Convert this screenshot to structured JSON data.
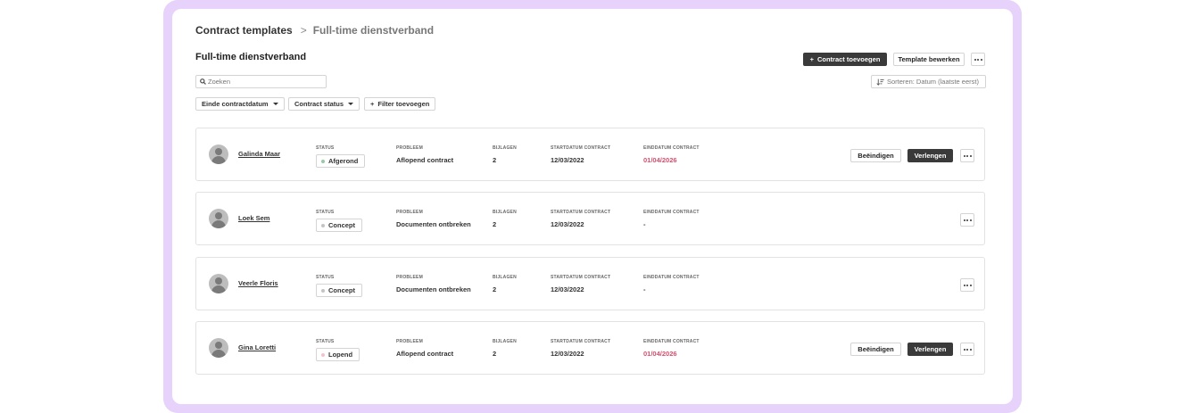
{
  "breadcrumb": {
    "root": "Contract templates",
    "separator": ">",
    "current": "Full-time dienstverband"
  },
  "page_title": "Full-time dienstverband",
  "toolbar": {
    "add_contract": "Contract toevoegen",
    "add_icon": "+",
    "edit_template": "Template bewerken"
  },
  "search": {
    "placeholder": "Zoeken",
    "value": ""
  },
  "sort": {
    "label": "Sorteren: Datum (laatste eerst)"
  },
  "filters": {
    "end_date": "Einde contractdatum",
    "status": "Contract status",
    "add_filter": "Filter toevoegen",
    "add_icon": "+"
  },
  "columns": {
    "status": "STATUS",
    "problem": "PROBLEEM",
    "attachments": "BIJLAGEN",
    "start": "STARTDATUM CONTRACT",
    "end": "EINDDATUM CONTRACT"
  },
  "actions": {
    "terminate": "Beëindigen",
    "renew": "Verlengen"
  },
  "rows": [
    {
      "name": "Galinda Maar",
      "status": "Afgerond",
      "status_color": "#9cc9a4",
      "problem": "Aflopend contract",
      "attachments": "2",
      "start": "12/03/2022",
      "end": "01/04/2026",
      "end_color": "#d2506e"
    },
    {
      "name": "Loek Sem",
      "status": "Concept",
      "status_color": "#c4c4c4",
      "problem": "Documenten ontbreken",
      "attachments": "2",
      "start": "12/03/2022",
      "end": "-",
      "end_color": "#333333"
    },
    {
      "name": "Veerle Floris",
      "status": "Concept",
      "status_color": "#c4c4c4",
      "problem": "Documenten ontbreken",
      "attachments": "2",
      "start": "12/03/2022",
      "end": "-",
      "end_color": "#333333"
    },
    {
      "name": "Gina Loretti",
      "status": "Lopend",
      "status_color": "#f3c4cf",
      "problem": "Aflopend contract",
      "attachments": "2",
      "start": "12/03/2022",
      "end": "01/04/2026",
      "end_color": "#d2506e"
    }
  ],
  "colors": {
    "frame": "#e6d2fa",
    "primary_button": "#3a3a3a",
    "overdue": "#d2506e"
  }
}
